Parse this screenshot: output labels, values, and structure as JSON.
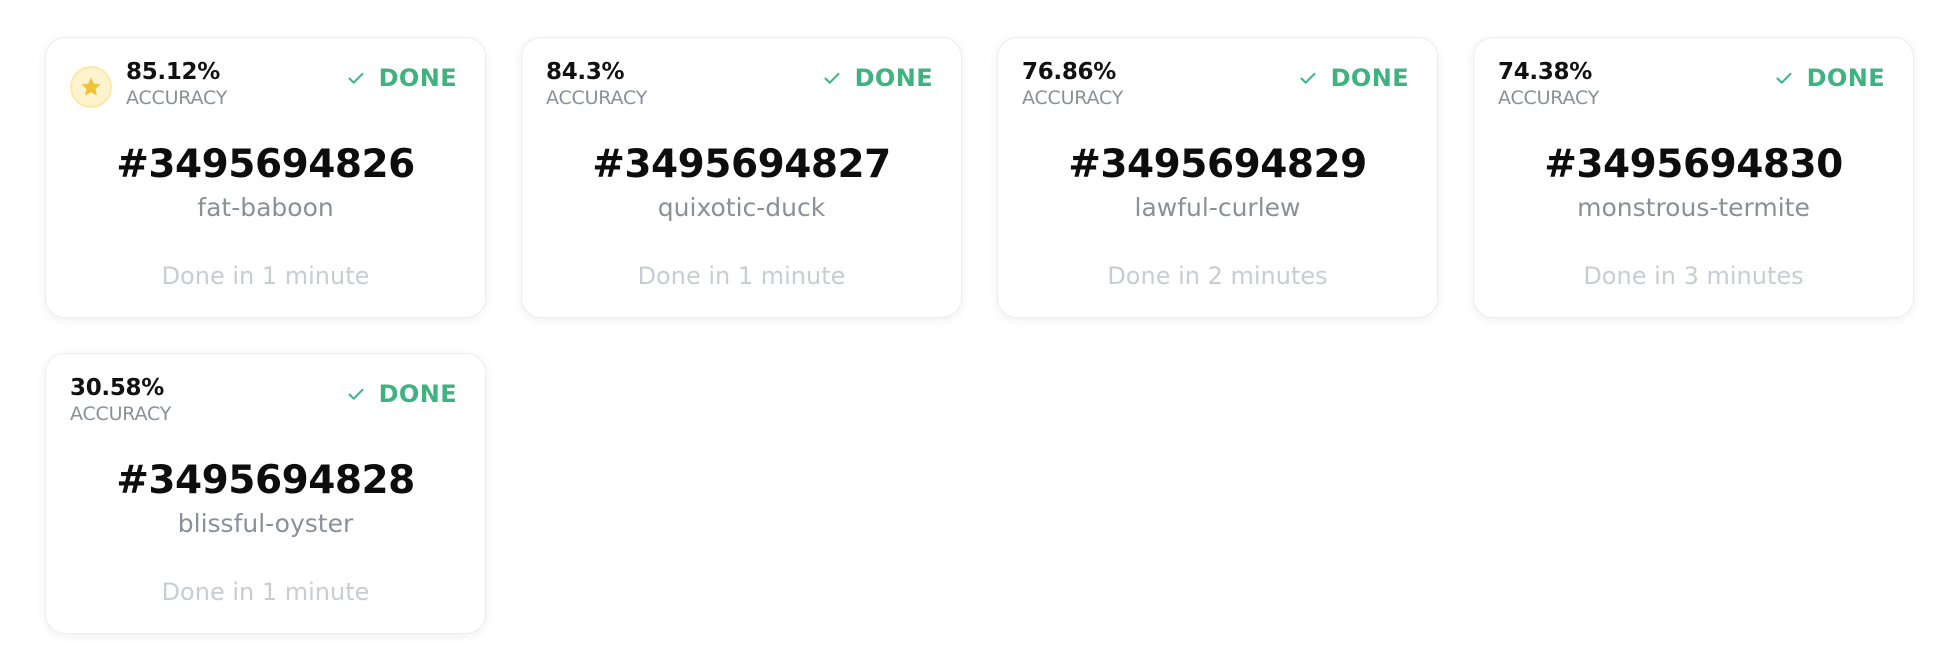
{
  "colors": {
    "done_green": "#3fb27f",
    "star_gold": "#f0c23a",
    "badge_bg": "#fdf3cf"
  },
  "runs": [
    {
      "accuracy": "85.12%",
      "accuracy_label": "ACCURACY",
      "status": "DONE",
      "status_icon": "check-icon",
      "id": "#3495694826",
      "name": "fat-baboon",
      "duration": "Done in 1 minute",
      "starred": true,
      "star_icon": "star-icon"
    },
    {
      "accuracy": "84.3%",
      "accuracy_label": "ACCURACY",
      "status": "DONE",
      "status_icon": "check-icon",
      "id": "#3495694827",
      "name": "quixotic-duck",
      "duration": "Done in 1 minute",
      "starred": false
    },
    {
      "accuracy": "76.86%",
      "accuracy_label": "ACCURACY",
      "status": "DONE",
      "status_icon": "check-icon",
      "id": "#3495694829",
      "name": "lawful-curlew",
      "duration": "Done in 2 minutes",
      "starred": false
    },
    {
      "accuracy": "74.38%",
      "accuracy_label": "ACCURACY",
      "status": "DONE",
      "status_icon": "check-icon",
      "id": "#3495694830",
      "name": "monstrous-termite",
      "duration": "Done in 3 minutes",
      "starred": false
    },
    {
      "accuracy": "30.58%",
      "accuracy_label": "ACCURACY",
      "status": "DONE",
      "status_icon": "check-icon",
      "id": "#3495694828",
      "name": "blissful-oyster",
      "duration": "Done in 1 minute",
      "starred": false
    }
  ]
}
